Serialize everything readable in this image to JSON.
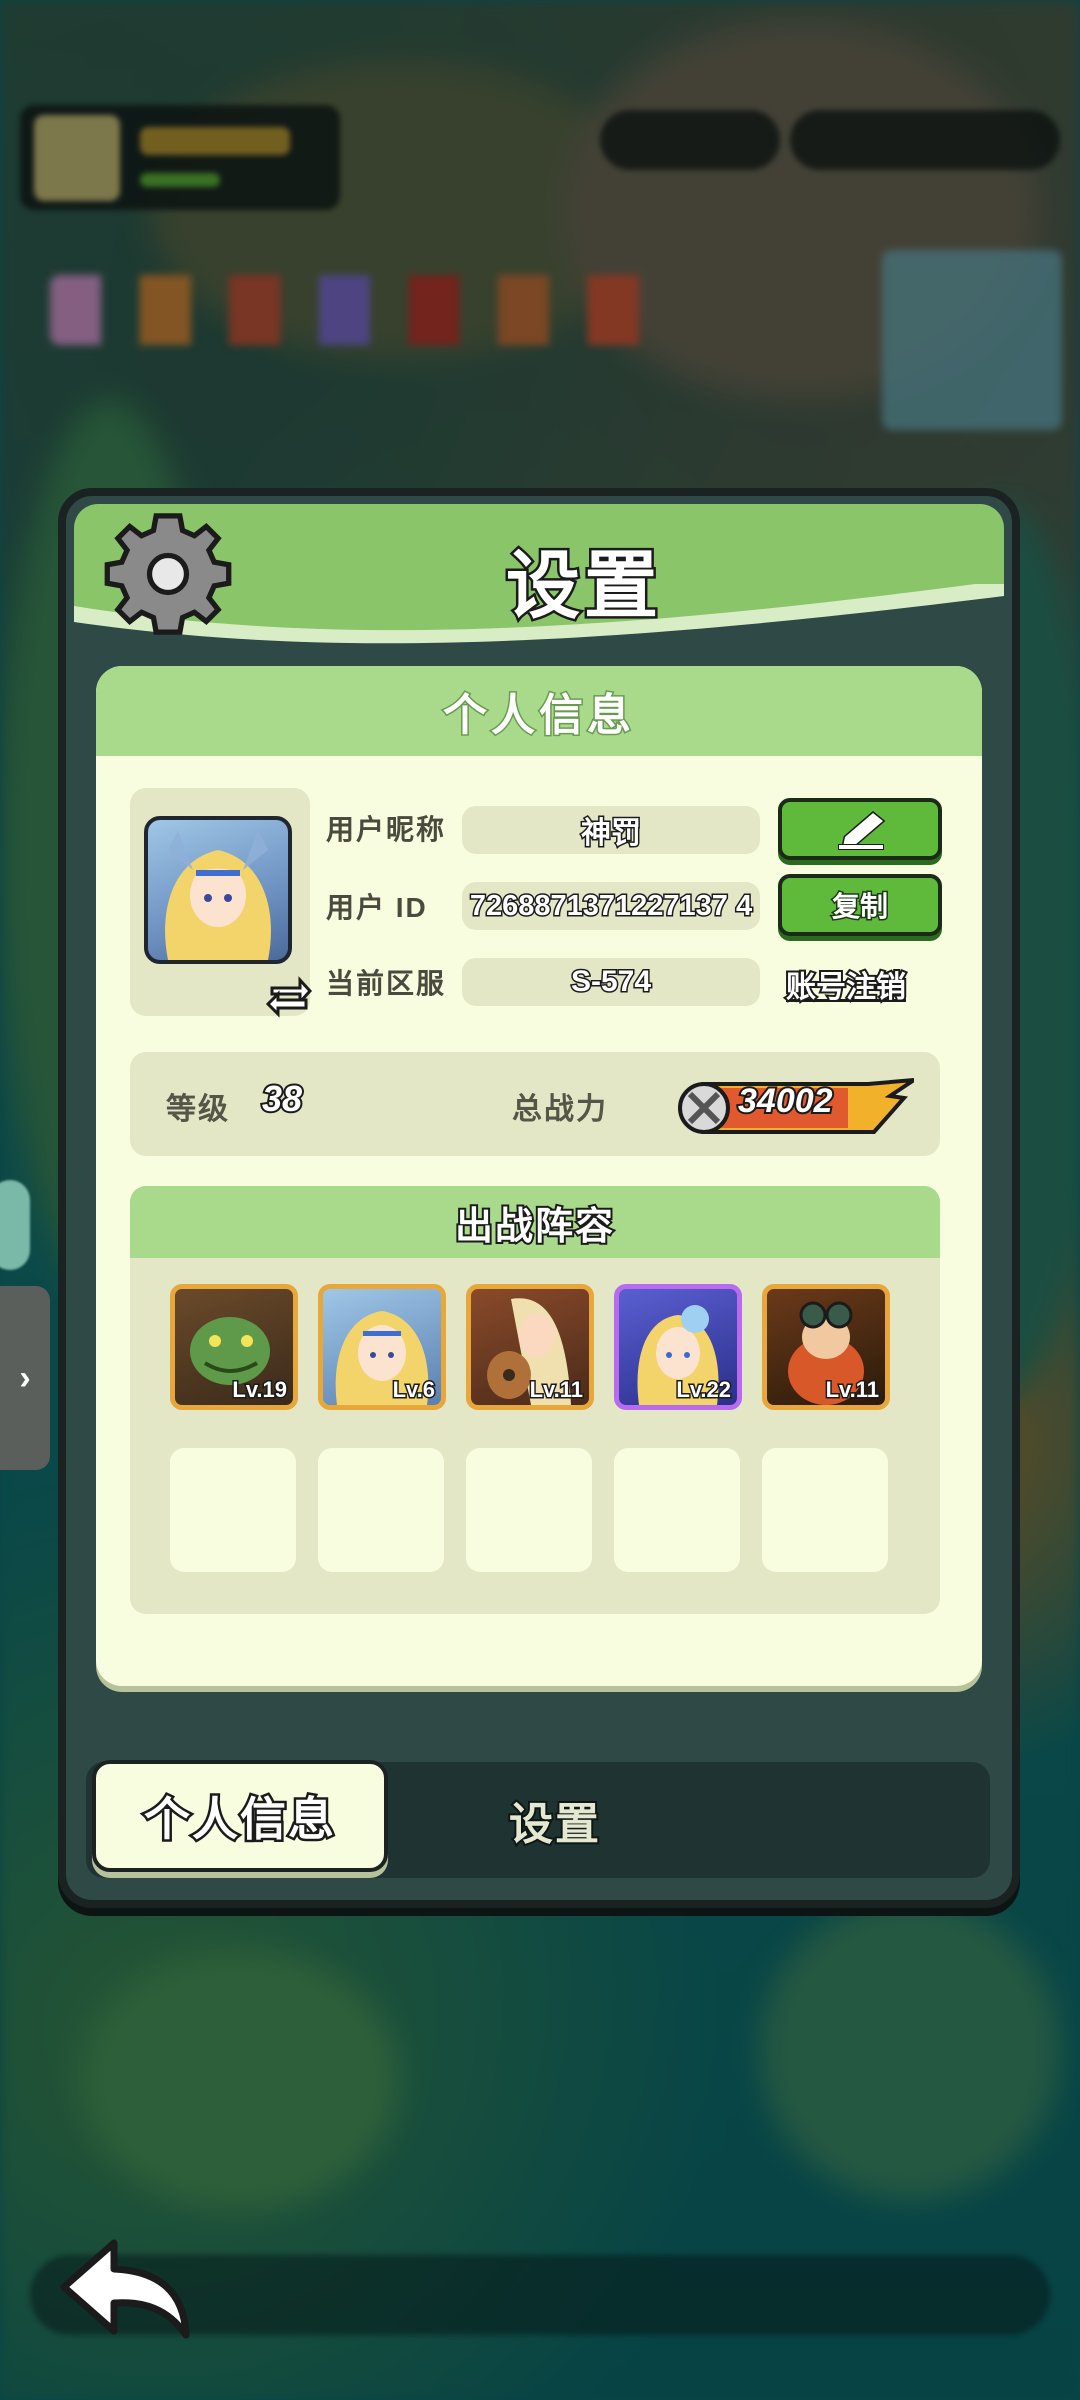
{
  "dialog": {
    "title": "设置"
  },
  "profile": {
    "section_title": "个人信息",
    "nickname_label": "用户昵称",
    "nickname_value": "神罚",
    "user_id_label": "用户 ID",
    "user_id_value": "7268871371227137 4",
    "server_label": "当前区服",
    "server_value": "S-574",
    "copy_button": "复制",
    "cancel_account": "账号注销",
    "edit_icon": "pencil-icon",
    "avatar_swap_icon": "swap-arrows-icon"
  },
  "stats": {
    "level_label": "等级",
    "level_value": "38",
    "power_label": "总战力",
    "power_value": "34002"
  },
  "lineup": {
    "title": "出战阵容",
    "heroes": [
      {
        "level": "Lv.19",
        "rarity_color": "#e8a73a"
      },
      {
        "level": "Lv.6",
        "rarity_color": "#e8a73a"
      },
      {
        "level": "Lv.11",
        "rarity_color": "#e8a73a"
      },
      {
        "level": "Lv.22",
        "rarity_color": "#b86bef"
      },
      {
        "level": "Lv.11",
        "rarity_color": "#e8a73a"
      }
    ]
  },
  "tabs": {
    "active": "个人信息",
    "inactive": "设置"
  },
  "colors": {
    "accent_green": "#5fba3c",
    "header_green": "#8ac56a",
    "card_bg": "#f8fddf"
  }
}
